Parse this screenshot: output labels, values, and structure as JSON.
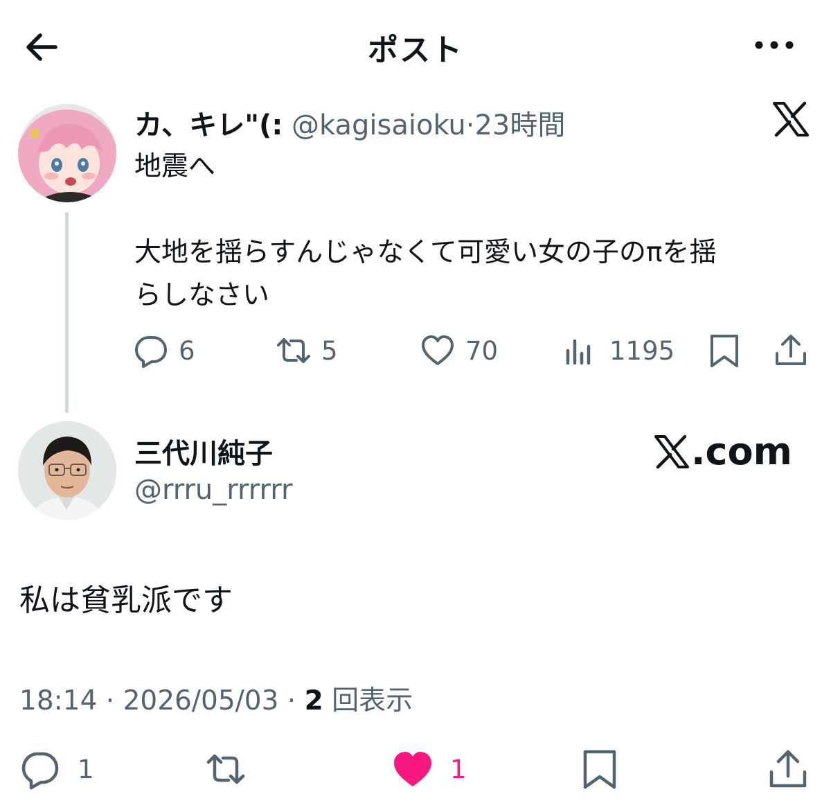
{
  "header": {
    "title": "ポスト",
    "back_icon": "arrow-left-icon",
    "more_icon": "more-dots-icon"
  },
  "parent_post": {
    "name": "カ、キレ\"(:",
    "handle": "@kagisaioku",
    "dot": "·",
    "time": "23時間",
    "text_line1": "地震へ",
    "text_line2": "大地を揺らすんじゃなくて可愛い女の子のπを揺",
    "text_line3": "らしなさい",
    "actions": {
      "replies": "6",
      "reposts": "5",
      "likes": "70",
      "views": "1195"
    }
  },
  "quote_user": {
    "name": "三代川純子",
    "handle": "@rrru_rrrrrr",
    "watermark": ".com"
  },
  "reply_text": "私は貧乳派です",
  "meta": {
    "time": "18:14",
    "sep1": " · ",
    "date": "2026/05/03",
    "sep2": " · ",
    "views_count": "2",
    "views_label": " 回表示"
  },
  "bottom_actions": {
    "replies": "1",
    "likes": "1",
    "like_color": "#f91880"
  },
  "colors": {
    "text": "#0f1419",
    "secondary": "#536471",
    "thread_line": "#cfd9de"
  }
}
